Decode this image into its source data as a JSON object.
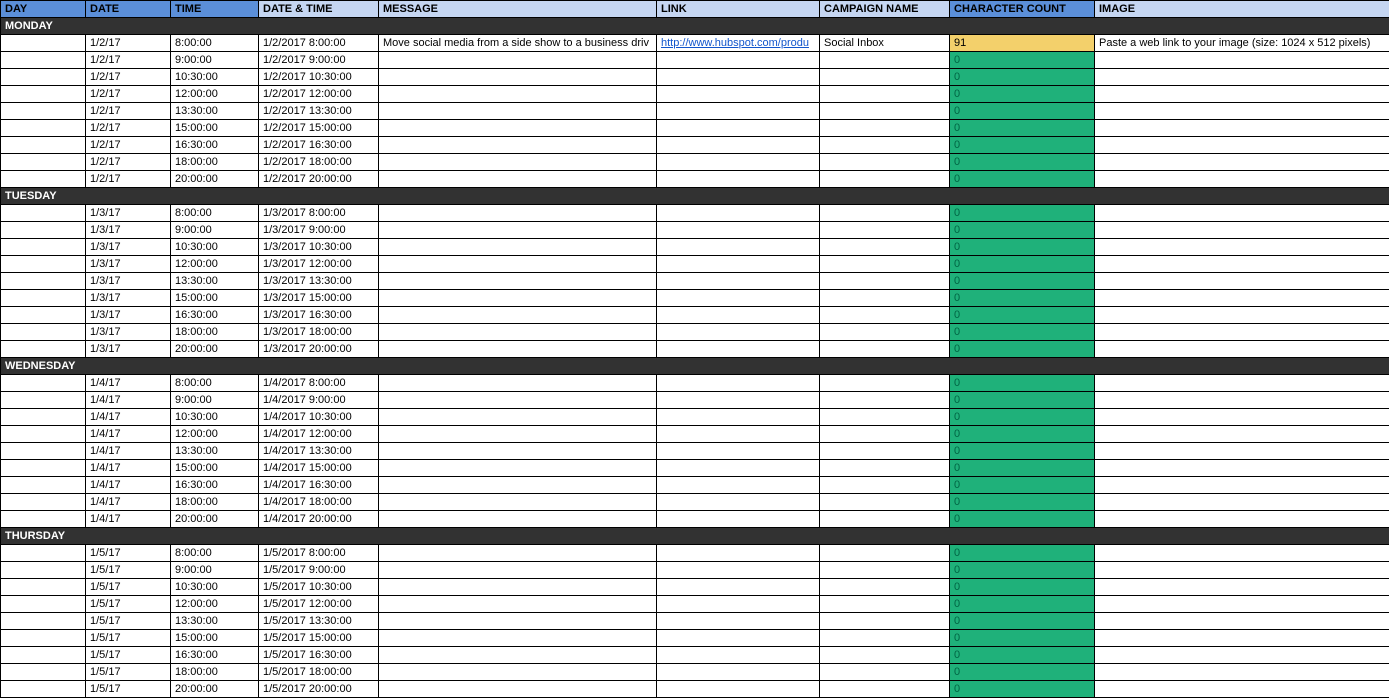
{
  "headers": {
    "day": "DAY",
    "date": "DATE",
    "time": "TIME",
    "datetime": "DATE & TIME",
    "message": "MESSAGE",
    "link": "LINK",
    "campaign": "CAMPAIGN NAME",
    "charcount": "CHARACTER COUNT",
    "image": "IMAGE"
  },
  "days": [
    {
      "label": "MONDAY",
      "rows": [
        {
          "date": "1/2/17",
          "time": "8:00:00",
          "datetime": "1/2/2017 8:00:00",
          "message": "Move social media from a side show to a business driv",
          "link": "http://www.hubspot.com/produ",
          "campaign": "Social Inbox",
          "charcount": "91",
          "cc_style": "cc-yellow",
          "image": "Paste a web link to your image (size: 1024 x 512 pixels)"
        },
        {
          "date": "1/2/17",
          "time": "9:00:00",
          "datetime": "1/2/2017 9:00:00",
          "message": "",
          "link": "",
          "campaign": "",
          "charcount": "0",
          "cc_style": "cc-green",
          "image": ""
        },
        {
          "date": "1/2/17",
          "time": "10:30:00",
          "datetime": "1/2/2017 10:30:00",
          "message": "",
          "link": "",
          "campaign": "",
          "charcount": "0",
          "cc_style": "cc-green",
          "image": ""
        },
        {
          "date": "1/2/17",
          "time": "12:00:00",
          "datetime": "1/2/2017 12:00:00",
          "message": "",
          "link": "",
          "campaign": "",
          "charcount": "0",
          "cc_style": "cc-green",
          "image": ""
        },
        {
          "date": "1/2/17",
          "time": "13:30:00",
          "datetime": "1/2/2017 13:30:00",
          "message": "",
          "link": "",
          "campaign": "",
          "charcount": "0",
          "cc_style": "cc-green",
          "image": ""
        },
        {
          "date": "1/2/17",
          "time": "15:00:00",
          "datetime": "1/2/2017 15:00:00",
          "message": "",
          "link": "",
          "campaign": "",
          "charcount": "0",
          "cc_style": "cc-green",
          "image": ""
        },
        {
          "date": "1/2/17",
          "time": "16:30:00",
          "datetime": "1/2/2017 16:30:00",
          "message": "",
          "link": "",
          "campaign": "",
          "charcount": "0",
          "cc_style": "cc-green",
          "image": ""
        },
        {
          "date": "1/2/17",
          "time": "18:00:00",
          "datetime": "1/2/2017 18:00:00",
          "message": "",
          "link": "",
          "campaign": "",
          "charcount": "0",
          "cc_style": "cc-green",
          "image": ""
        },
        {
          "date": "1/2/17",
          "time": "20:00:00",
          "datetime": "1/2/2017 20:00:00",
          "message": "",
          "link": "",
          "campaign": "",
          "charcount": "0",
          "cc_style": "cc-green",
          "image": ""
        }
      ]
    },
    {
      "label": "TUESDAY",
      "rows": [
        {
          "date": "1/3/17",
          "time": "8:00:00",
          "datetime": "1/3/2017 8:00:00",
          "message": "",
          "link": "",
          "campaign": "",
          "charcount": "0",
          "cc_style": "cc-green",
          "image": ""
        },
        {
          "date": "1/3/17",
          "time": "9:00:00",
          "datetime": "1/3/2017 9:00:00",
          "message": "",
          "link": "",
          "campaign": "",
          "charcount": "0",
          "cc_style": "cc-green",
          "image": ""
        },
        {
          "date": "1/3/17",
          "time": "10:30:00",
          "datetime": "1/3/2017 10:30:00",
          "message": "",
          "link": "",
          "campaign": "",
          "charcount": "0",
          "cc_style": "cc-green",
          "image": ""
        },
        {
          "date": "1/3/17",
          "time": "12:00:00",
          "datetime": "1/3/2017 12:00:00",
          "message": "",
          "link": "",
          "campaign": "",
          "charcount": "0",
          "cc_style": "cc-green",
          "image": ""
        },
        {
          "date": "1/3/17",
          "time": "13:30:00",
          "datetime": "1/3/2017 13:30:00",
          "message": "",
          "link": "",
          "campaign": "",
          "charcount": "0",
          "cc_style": "cc-green",
          "image": ""
        },
        {
          "date": "1/3/17",
          "time": "15:00:00",
          "datetime": "1/3/2017 15:00:00",
          "message": "",
          "link": "",
          "campaign": "",
          "charcount": "0",
          "cc_style": "cc-green",
          "image": ""
        },
        {
          "date": "1/3/17",
          "time": "16:30:00",
          "datetime": "1/3/2017 16:30:00",
          "message": "",
          "link": "",
          "campaign": "",
          "charcount": "0",
          "cc_style": "cc-green",
          "image": ""
        },
        {
          "date": "1/3/17",
          "time": "18:00:00",
          "datetime": "1/3/2017 18:00:00",
          "message": "",
          "link": "",
          "campaign": "",
          "charcount": "0",
          "cc_style": "cc-green",
          "image": ""
        },
        {
          "date": "1/3/17",
          "time": "20:00:00",
          "datetime": "1/3/2017 20:00:00",
          "message": "",
          "link": "",
          "campaign": "",
          "charcount": "0",
          "cc_style": "cc-green",
          "image": ""
        }
      ]
    },
    {
      "label": "WEDNESDAY",
      "rows": [
        {
          "date": "1/4/17",
          "time": "8:00:00",
          "datetime": "1/4/2017 8:00:00",
          "message": "",
          "link": "",
          "campaign": "",
          "charcount": "0",
          "cc_style": "cc-green",
          "image": ""
        },
        {
          "date": "1/4/17",
          "time": "9:00:00",
          "datetime": "1/4/2017 9:00:00",
          "message": "",
          "link": "",
          "campaign": "",
          "charcount": "0",
          "cc_style": "cc-green",
          "image": ""
        },
        {
          "date": "1/4/17",
          "time": "10:30:00",
          "datetime": "1/4/2017 10:30:00",
          "message": "",
          "link": "",
          "campaign": "",
          "charcount": "0",
          "cc_style": "cc-green",
          "image": ""
        },
        {
          "date": "1/4/17",
          "time": "12:00:00",
          "datetime": "1/4/2017 12:00:00",
          "message": "",
          "link": "",
          "campaign": "",
          "charcount": "0",
          "cc_style": "cc-green",
          "image": ""
        },
        {
          "date": "1/4/17",
          "time": "13:30:00",
          "datetime": "1/4/2017 13:30:00",
          "message": "",
          "link": "",
          "campaign": "",
          "charcount": "0",
          "cc_style": "cc-green",
          "image": ""
        },
        {
          "date": "1/4/17",
          "time": "15:00:00",
          "datetime": "1/4/2017 15:00:00",
          "message": "",
          "link": "",
          "campaign": "",
          "charcount": "0",
          "cc_style": "cc-green",
          "image": ""
        },
        {
          "date": "1/4/17",
          "time": "16:30:00",
          "datetime": "1/4/2017 16:30:00",
          "message": "",
          "link": "",
          "campaign": "",
          "charcount": "0",
          "cc_style": "cc-green",
          "image": ""
        },
        {
          "date": "1/4/17",
          "time": "18:00:00",
          "datetime": "1/4/2017 18:00:00",
          "message": "",
          "link": "",
          "campaign": "",
          "charcount": "0",
          "cc_style": "cc-green",
          "image": ""
        },
        {
          "date": "1/4/17",
          "time": "20:00:00",
          "datetime": "1/4/2017 20:00:00",
          "message": "",
          "link": "",
          "campaign": "",
          "charcount": "0",
          "cc_style": "cc-green",
          "image": ""
        }
      ]
    },
    {
      "label": "THURSDAY",
      "rows": [
        {
          "date": "1/5/17",
          "time": "8:00:00",
          "datetime": "1/5/2017 8:00:00",
          "message": "",
          "link": "",
          "campaign": "",
          "charcount": "0",
          "cc_style": "cc-green",
          "image": ""
        },
        {
          "date": "1/5/17",
          "time": "9:00:00",
          "datetime": "1/5/2017 9:00:00",
          "message": "",
          "link": "",
          "campaign": "",
          "charcount": "0",
          "cc_style": "cc-green",
          "image": ""
        },
        {
          "date": "1/5/17",
          "time": "10:30:00",
          "datetime": "1/5/2017 10:30:00",
          "message": "",
          "link": "",
          "campaign": "",
          "charcount": "0",
          "cc_style": "cc-green",
          "image": ""
        },
        {
          "date": "1/5/17",
          "time": "12:00:00",
          "datetime": "1/5/2017 12:00:00",
          "message": "",
          "link": "",
          "campaign": "",
          "charcount": "0",
          "cc_style": "cc-green",
          "image": ""
        },
        {
          "date": "1/5/17",
          "time": "13:30:00",
          "datetime": "1/5/2017 13:30:00",
          "message": "",
          "link": "",
          "campaign": "",
          "charcount": "0",
          "cc_style": "cc-green",
          "image": ""
        },
        {
          "date": "1/5/17",
          "time": "15:00:00",
          "datetime": "1/5/2017 15:00:00",
          "message": "",
          "link": "",
          "campaign": "",
          "charcount": "0",
          "cc_style": "cc-green",
          "image": ""
        },
        {
          "date": "1/5/17",
          "time": "16:30:00",
          "datetime": "1/5/2017 16:30:00",
          "message": "",
          "link": "",
          "campaign": "",
          "charcount": "0",
          "cc_style": "cc-green",
          "image": ""
        },
        {
          "date": "1/5/17",
          "time": "18:00:00",
          "datetime": "1/5/2017 18:00:00",
          "message": "",
          "link": "",
          "campaign": "",
          "charcount": "0",
          "cc_style": "cc-green",
          "image": ""
        },
        {
          "date": "1/5/17",
          "time": "20:00:00",
          "datetime": "1/5/2017 20:00:00",
          "message": "",
          "link": "",
          "campaign": "",
          "charcount": "0",
          "cc_style": "cc-green",
          "image": ""
        }
      ]
    }
  ]
}
